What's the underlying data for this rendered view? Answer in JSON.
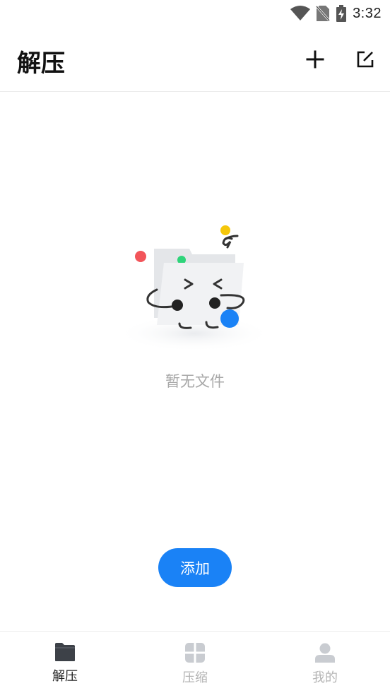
{
  "status_bar": {
    "time": "3:32",
    "icons": [
      "wifi-icon",
      "no-sim-icon",
      "battery-charging-icon"
    ]
  },
  "app_bar": {
    "title": "解压",
    "actions": [
      "add-icon",
      "edit-icon"
    ]
  },
  "empty_state": {
    "message": "暂无文件",
    "illustration": "empty-folder-illustration"
  },
  "primary_action": {
    "label": "添加"
  },
  "tabs": [
    {
      "label": "解压",
      "icon": "folder-icon",
      "active": true
    },
    {
      "label": "压缩",
      "icon": "grid-icon",
      "active": false
    },
    {
      "label": "我的",
      "icon": "person-icon",
      "active": false
    }
  ],
  "colors": {
    "accent": "#1a82f6",
    "active_tab": "#3d4148",
    "inactive_tab": "#c9ccd1",
    "muted_text": "#a8a8a8"
  }
}
